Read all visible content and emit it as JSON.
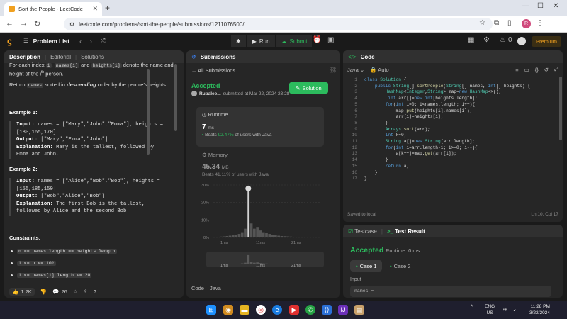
{
  "browser": {
    "tab_title": "Sort the People - LeetCode",
    "url": "leetcode.com/problems/sort-the-people/submissions/1211076500/",
    "profile_letter": "R"
  },
  "topbar": {
    "problem_list": "Problem List",
    "run": "Run",
    "submit": "Submit",
    "streak": "0",
    "premium": "Premium"
  },
  "description": {
    "tabs": [
      "Description",
      "Editorial",
      "Solutions"
    ],
    "line1a": "For each index ",
    "line1_code1": "i",
    "line1b": ", ",
    "line1_code2": "names[i]",
    "line1c": " and ",
    "line1_code3": "heights[i]",
    "line1d": " denote the name and",
    "line2a": "height of the ",
    "line2_sup": "th",
    "line2_i": "i",
    "line2b": " person.",
    "ret_a": "Return ",
    "ret_code": "names",
    "ret_b": " sorted in ",
    "ret_em": "descending",
    "ret_c": " order by the people's heights.",
    "ex1_title": "Example 1:",
    "ex1_in1": "names = [\"Mary\",\"John\",\"Emma\"], heights =",
    "ex1_in2": "[180,165,170]",
    "ex1_out": "[\"Mary\",\"Emma\",\"John\"]",
    "ex1_exp1": "Mary is the tallest, followed by",
    "ex1_exp2": "Emma and John.",
    "ex2_title": "Example 2:",
    "ex2_in1": "names = [\"Alice\",\"Bob\",\"Bob\"], heights =",
    "ex2_in2": "[155,185,150]",
    "ex2_out": "[\"Bob\",\"Alice\",\"Bob\"]",
    "ex2_exp1": "The first Bob is the tallest,",
    "ex2_exp2": "followed by Alice and the second Bob.",
    "input_label": "Input:",
    "output_label": "Output:",
    "explanation_label": "Explanation:",
    "constraints_title": "Constraints:",
    "constraints": [
      "n == names.length == heights.length",
      "1 <= n <= 10³",
      "1 <= names[i].length <= 20"
    ],
    "likes": "1.2K",
    "comments": "26"
  },
  "submissions": {
    "header": "Submissions",
    "all": "All Submissions",
    "status": "Accepted",
    "author": "Rupalee...",
    "submitted": "submitted at Mar 22, 2024 23:28",
    "solution_btn": "Solution",
    "runtime_title": "Runtime",
    "runtime_value": "7",
    "runtime_unit": "ms",
    "runtime_beats_pre": "Beats ",
    "runtime_beats_pct": "92.47%",
    "runtime_beats_post": " of users with Java",
    "memory_title": "Memory",
    "memory_value": "45.34",
    "memory_unit": "MB",
    "memory_beats": "Beats 41.11% of users with Java",
    "code_label": "Code",
    "lang_label": "Java"
  },
  "chart_data": {
    "type": "bar",
    "y_ticks": [
      "30%",
      "20%",
      "10%",
      "0%"
    ],
    "x_ticks": [
      "1ms",
      "11ms",
      "21ms"
    ],
    "mini_x_ticks": [
      "1ms",
      "11ms",
      "21ms"
    ],
    "ylim": [
      0,
      30
    ],
    "values": [
      0.3,
      0.4,
      0.5,
      0.6,
      0.8,
      1.0,
      1.2,
      1.5,
      2,
      3,
      5,
      28,
      8,
      5,
      6,
      4,
      3,
      2.5,
      2,
      1.5,
      1.2,
      1,
      0.8,
      0.7,
      0.6,
      0.5,
      0.4,
      0.3,
      0.3,
      0.2,
      0.2,
      0.2,
      0.1,
      0.1,
      0.1
    ],
    "highlight_index": 11
  },
  "code": {
    "header": "Code",
    "lang": "Java",
    "mode": "Auto",
    "saved": "Saved to local",
    "position": "Ln 10, Col 17",
    "lines": [
      "class Solution {",
      "    public String[] sortPeople(String[] names, int[] heights) {",
      "        HashMap<Integer,String> map=new HashMap<>();",
      "         int arr[]=new int[heights.length];",
      "        for(int i=0; i<names.length; i++){",
      "            map.put(heights[i],names[i]);",
      "            arr[i]=heights[i];",
      "        }",
      "        Arrays.sort(arr);",
      "        int k=0;",
      "        String a[]=new String[arr.length];",
      "        for(int i=arr.length-1; i>=0; i--){",
      "            a[k++]=map.get(arr[i]);",
      "        }",
      "        return a;",
      "    }",
      "}"
    ]
  },
  "result": {
    "tab_testcase": "Testcase",
    "tab_result": "Test Result",
    "status": "Accepted",
    "runtime": "Runtime: 0 ms",
    "case1": "Case 1",
    "case2": "Case 2",
    "input_label": "Input",
    "input_value": "names ="
  },
  "taskbar": {
    "lang1": "ENG",
    "lang2": "US",
    "time": "11:28 PM",
    "date": "3/22/2024"
  },
  "colors": {
    "accent_green": "#2cbb5d",
    "premium": "#f0a020"
  }
}
